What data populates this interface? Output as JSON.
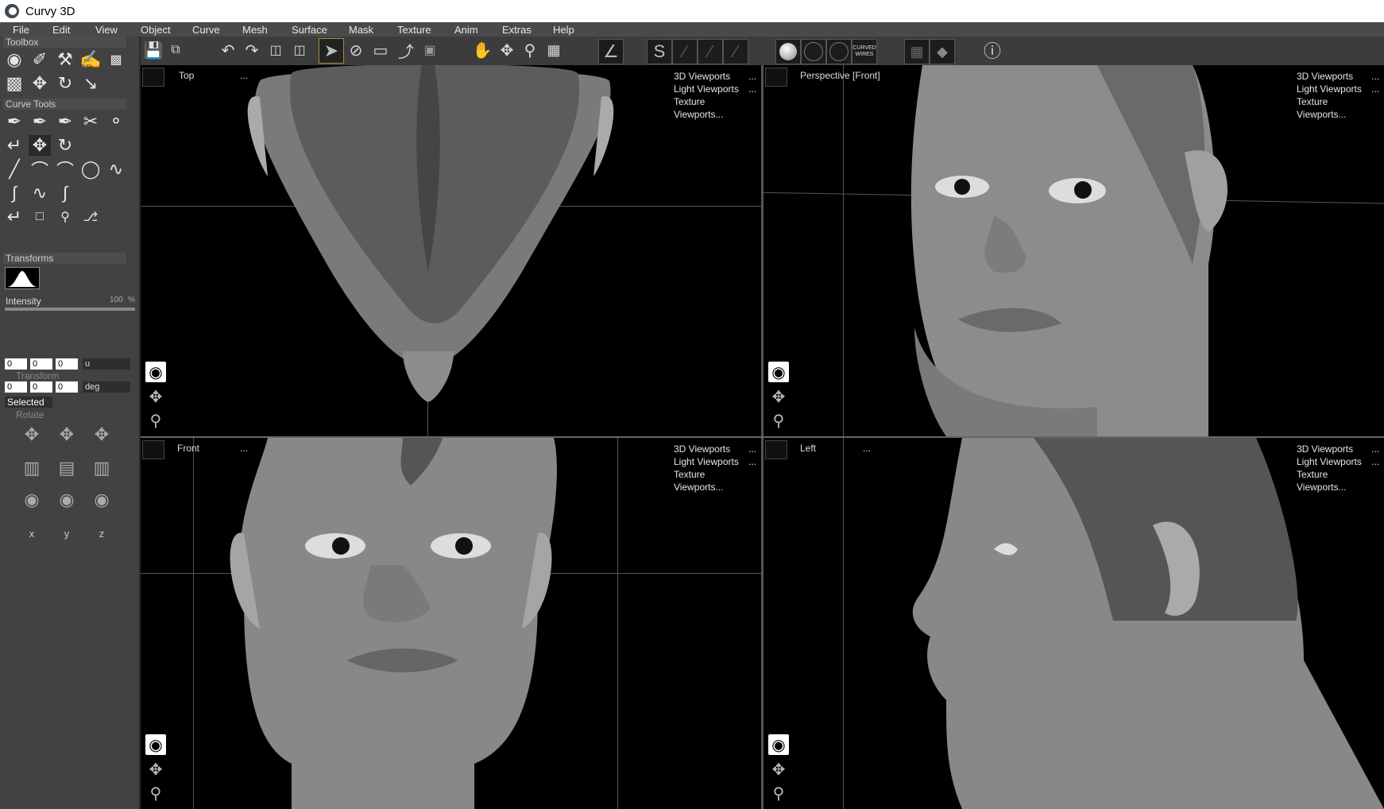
{
  "window": {
    "title": "Curvy 3D"
  },
  "menu": [
    "File",
    "Edit",
    "View",
    "Object",
    "Curve",
    "Mesh",
    "Surface",
    "Mask",
    "Texture",
    "Anim",
    "Extras",
    "Help"
  ],
  "toolbar": {
    "curved_wires_label": "CURVED WIRES"
  },
  "sidebar": {
    "toolbox_header": "Toolbox",
    "curve_tools_header": "Curve Tools",
    "transforms_header": "Transforms",
    "intensity_label": "Intensity",
    "intensity_value": "100",
    "intensity_unit": "%",
    "intensity_level": 1.0,
    "translate": {
      "x": "0",
      "y": "0",
      "z": "0",
      "unit": "u"
    },
    "transform_label": "Transform",
    "rotate": {
      "x": "0",
      "y": "0",
      "z": "0",
      "unit": "deg"
    },
    "selected_label": "Selected",
    "rotate_label": "Rotate",
    "axis_labels": [
      "x",
      "y",
      "z"
    ]
  },
  "viewports": [
    {
      "name": "Top",
      "dots": "...",
      "menu": [
        "3D Viewports",
        "Light Viewports",
        "Texture Viewports..."
      ]
    },
    {
      "name": "Perspective [Front]",
      "dots": "",
      "menu": [
        "3D Viewports",
        "Light Viewports",
        "Texture Viewports..."
      ]
    },
    {
      "name": "Front",
      "dots": "...",
      "menu": [
        "3D Viewports",
        "Light Viewports",
        "Texture Viewports..."
      ]
    },
    {
      "name": "Left",
      "dots": "...",
      "menu": [
        "3D Viewports",
        "Light Viewports",
        "Texture Viewports..."
      ]
    }
  ],
  "colors": {
    "viewport_bg": "#000000",
    "panel_bg": "#424242",
    "skin": "#8a8a8a"
  }
}
